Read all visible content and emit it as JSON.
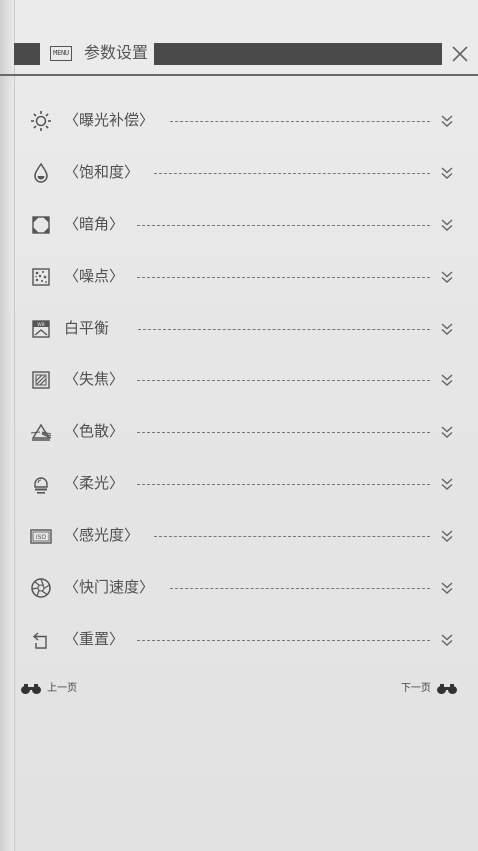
{
  "header": {
    "menu_icon_text": "MENU",
    "title": "参数设置",
    "close_icon": "close-icon"
  },
  "items": [
    {
      "label": "〈曝光补偿〉",
      "icon": "exposure-sun-icon"
    },
    {
      "label": "〈饱和度〉",
      "icon": "saturation-drop-icon"
    },
    {
      "label": "〈暗角〉",
      "icon": "vignette-frame-icon"
    },
    {
      "label": "〈噪点〉",
      "icon": "noise-dots-icon"
    },
    {
      "label": "白平衡",
      "icon": "white-balance-icon"
    },
    {
      "label": "〈失焦〉",
      "icon": "defocus-icon"
    },
    {
      "label": "〈色散〉",
      "icon": "dispersion-prism-icon"
    },
    {
      "label": "〈柔光〉",
      "icon": "soft-light-bulb-icon"
    },
    {
      "label": "〈感光度〉",
      "icon": "iso-icon"
    },
    {
      "label": "〈快门速度〉",
      "icon": "shutter-aperture-icon"
    },
    {
      "label": "〈重置〉",
      "icon": "reset-icon"
    }
  ],
  "iso_icon_text": "ISO",
  "footer": {
    "prev_label": "上一页",
    "next_label": "下一页"
  }
}
